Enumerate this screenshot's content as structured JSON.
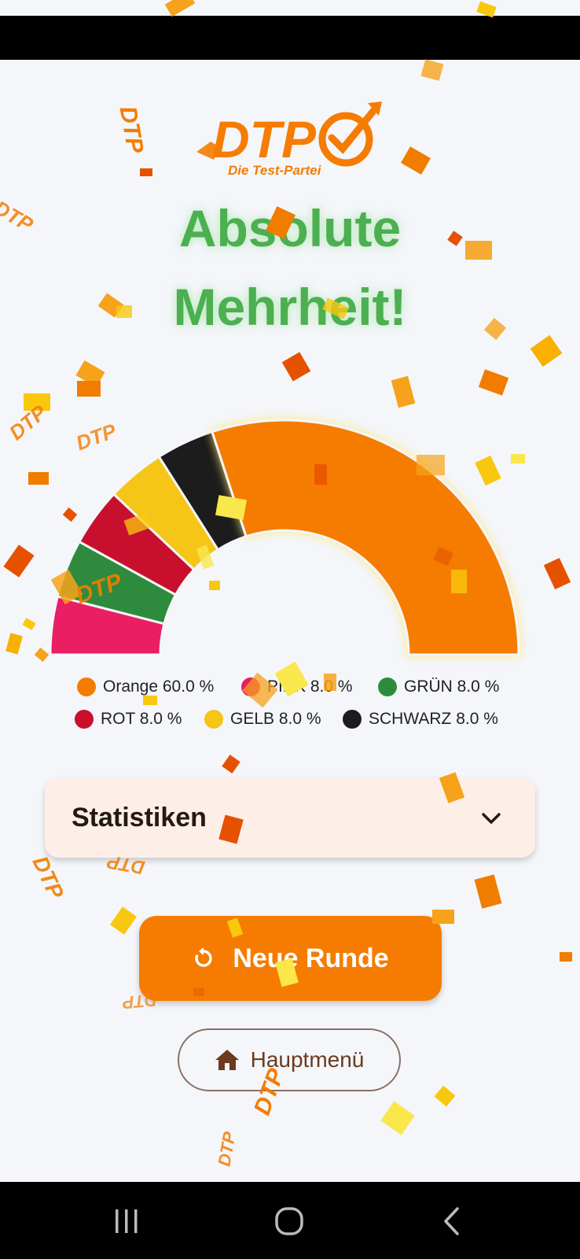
{
  "logo": {
    "wordmark": "DTP",
    "subtitle": "Die Test-Partei"
  },
  "headline": {
    "line1": "Absolute",
    "line2": "Mehrheit!"
  },
  "chart_data": {
    "type": "pie",
    "style": "semicircle-parliament",
    "slices": [
      {
        "label": "PINK",
        "value": 8.0,
        "color": "#e91e63"
      },
      {
        "label": "GRÜN",
        "value": 8.0,
        "color": "#2e8b3d"
      },
      {
        "label": "ROT",
        "value": 8.0,
        "color": "#c8102e"
      },
      {
        "label": "GELB",
        "value": 8.0,
        "color": "#f5c518"
      },
      {
        "label": "SCHWARZ",
        "value": 8.0,
        "color": "#1c1c1c"
      },
      {
        "label": "Orange",
        "value": 60.0,
        "color": "#f57c00"
      }
    ]
  },
  "legend": [
    {
      "text": "Orange 60.0 %",
      "color": "#f57c00"
    },
    {
      "text": "PINK 8.0 %",
      "color": "#e91e63"
    },
    {
      "text": "GRÜN 8.0 %",
      "color": "#2e8b3d"
    },
    {
      "text": "ROT 8.0 %",
      "color": "#c8102e"
    },
    {
      "text": "GELB 8.0 %",
      "color": "#f5c518"
    },
    {
      "text": "SCHWARZ 8.0 %",
      "color": "#1c1c1c"
    }
  ],
  "stats": {
    "title": "Statistiken",
    "icon": "chevron-down-icon"
  },
  "buttons": {
    "new_round": {
      "label": "Neue Runde",
      "icon": "restart-icon"
    },
    "main_menu": {
      "label": "Hauptmenü",
      "icon": "home-icon"
    }
  },
  "navigation": {
    "icons": [
      "recent-apps-icon",
      "home-circle-icon",
      "back-icon"
    ]
  },
  "colors": {
    "accent": "#f57c00",
    "headline": "#4caf50",
    "card": "#fdeee8"
  }
}
